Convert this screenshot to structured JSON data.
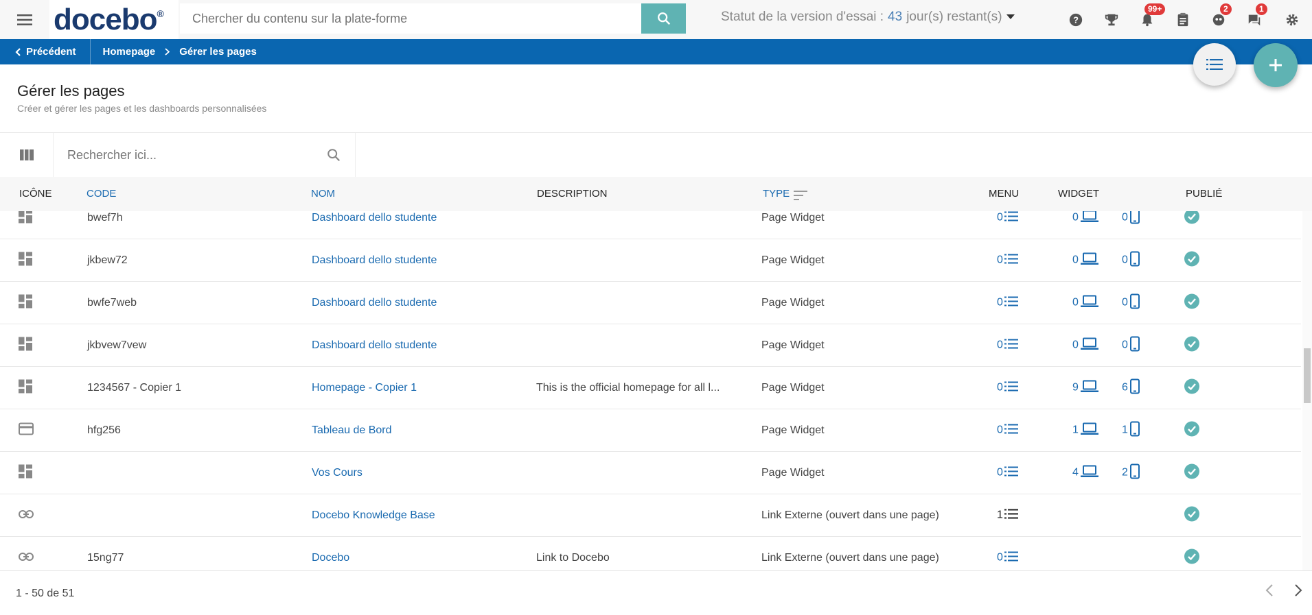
{
  "topbar": {
    "logo": "docebo",
    "logo_mark": "®",
    "search_placeholder": "Chercher du contenu sur la plate-forme",
    "trial_label": "Statut de la version d'essai :",
    "trial_days": "43",
    "trial_suffix": "jour(s) restant(s)",
    "badges": {
      "notifications": "99+",
      "tasks": "2",
      "messages": "1"
    }
  },
  "breadcrumb": {
    "back": "Précédent",
    "items": [
      "Homepage",
      "Gérer les pages"
    ]
  },
  "header": {
    "title": "Gérer les pages",
    "subtitle": "Créer et gérer les pages et les dashboards personnalisées"
  },
  "table_search": {
    "placeholder": "Rechercher ici..."
  },
  "columns": {
    "icone": "ICÔNE",
    "code": "CODE",
    "nom": "NOM",
    "description": "DESCRIPTION",
    "type": "TYPE",
    "menu": "MENU",
    "widget": "WIDGET",
    "publie": "PUBLIÉ"
  },
  "rows": [
    {
      "icon": "dashboard-icon",
      "code": "bwef7h",
      "nom": "Dashboard dello studente",
      "description": "",
      "type": "Page Widget",
      "menu": "0",
      "wd": "0",
      "wm": "0"
    },
    {
      "icon": "dashboard-icon",
      "code": "jkbew72",
      "nom": "Dashboard dello studente",
      "description": "",
      "type": "Page Widget",
      "menu": "0",
      "wd": "0",
      "wm": "0"
    },
    {
      "icon": "dashboard-icon",
      "code": "bwfe7web",
      "nom": "Dashboard dello studente",
      "description": "",
      "type": "Page Widget",
      "menu": "0",
      "wd": "0",
      "wm": "0"
    },
    {
      "icon": "dashboard-icon",
      "code": "jkbvew7vew",
      "nom": "Dashboard dello studente",
      "description": "",
      "type": "Page Widget",
      "menu": "0",
      "wd": "0",
      "wm": "0"
    },
    {
      "icon": "dashboard-icon",
      "code": "1234567 - Copier 1",
      "nom": "Homepage - Copier 1",
      "description": "This is the official homepage for all l...",
      "type": "Page Widget",
      "menu": "0",
      "wd": "9",
      "wm": "6"
    },
    {
      "icon": "card-icon",
      "code": "hfg256",
      "nom": "Tableau de Bord",
      "description": "",
      "type": "Page Widget",
      "menu": "0",
      "wd": "1",
      "wm": "1"
    },
    {
      "icon": "dashboard-icon",
      "code": "",
      "nom": "Vos Cours",
      "description": "",
      "type": "Page Widget",
      "menu": "0",
      "wd": "4",
      "wm": "2"
    },
    {
      "icon": "link-icon",
      "code": "",
      "nom": "Docebo Knowledge Base",
      "description": "",
      "type": "Link Externe (ouvert dans une page)",
      "menu": "1",
      "wd": "",
      "wm": ""
    },
    {
      "icon": "link-icon",
      "code": "15ng77",
      "nom": "Docebo",
      "description": "Link to Docebo",
      "type": "Link Externe (ouvert dans une page)",
      "menu": "0",
      "wd": "",
      "wm": ""
    }
  ],
  "footer": {
    "page_info": "1 - 50 de 51"
  },
  "colors": {
    "accent": "#0a66b0",
    "teal": "#5fb3b3",
    "link": "#1a6ab0",
    "badge": "#e03a3a"
  }
}
